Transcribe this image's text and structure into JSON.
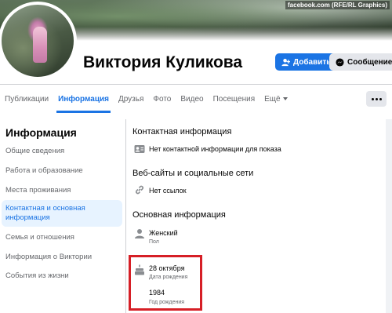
{
  "watermark": "facebook.com (RFE/RL Graphics)",
  "profile": {
    "name": "Виктория Куликова"
  },
  "actions": {
    "add_label": "Добавить",
    "message_label": "Сообщение"
  },
  "tabs": [
    {
      "label": "Публикации"
    },
    {
      "label": "Информация"
    },
    {
      "label": "Друзья"
    },
    {
      "label": "Фото"
    },
    {
      "label": "Видео"
    },
    {
      "label": "Посещения"
    },
    {
      "label": "Ещё"
    }
  ],
  "sidebar": {
    "title": "Информация",
    "items": [
      {
        "label": "Общие сведения"
      },
      {
        "label": "Работа и образование"
      },
      {
        "label": "Места проживания"
      },
      {
        "label": "Контактная и основная информация"
      },
      {
        "label": "Семья и отношения"
      },
      {
        "label": "Информация о Виктории"
      },
      {
        "label": "События из жизни"
      }
    ]
  },
  "content": {
    "contact": {
      "title": "Контактная информация",
      "value": "Нет контактной информации для показа"
    },
    "websites": {
      "title": "Веб-сайты и социальные сети",
      "value": "Нет ссылок"
    },
    "basic": {
      "title": "Основная информация",
      "gender_value": "Женский",
      "gender_label": "Пол",
      "birthday_value": "28 октября",
      "birthday_label": "Дата рождения",
      "year_value": "1984",
      "year_label": "Год рождения"
    }
  },
  "colors": {
    "accent": "#1b74e4",
    "highlight_border": "#d61f26",
    "background": "#f0f2f5"
  }
}
